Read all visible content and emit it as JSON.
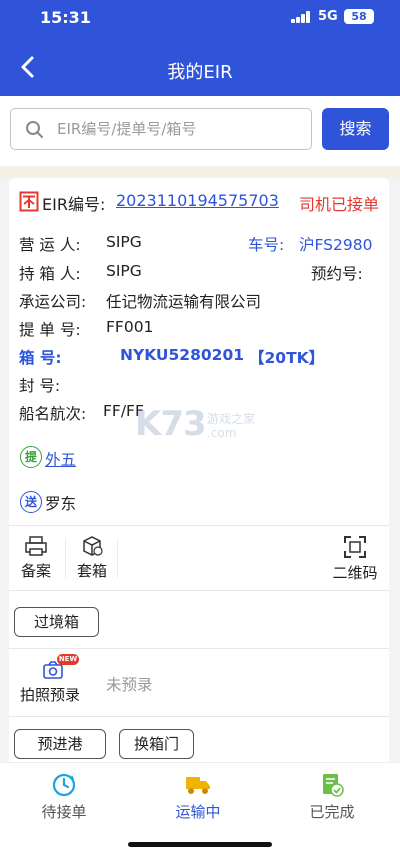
{
  "status": {
    "time": "15:31",
    "network": "5G",
    "battery": "58"
  },
  "nav": {
    "title": "我的EIR"
  },
  "search": {
    "placeholder": "EIR编号/提单号/箱号",
    "button": "搜索"
  },
  "card": {
    "eir_label": "EIR编号:",
    "eir_number": "2023110194575703",
    "status": "司机已接单",
    "operator_label": "营 运 人:",
    "operator_value": "SIPG",
    "plate_label": "车号:",
    "plate_value": "沪FS2980",
    "holder_label": "持 箱 人:",
    "holder_value": "SIPG",
    "appointment_label": "预约号:",
    "carrier_label": "承运公司:",
    "carrier_value": "任记物流运输有限公司",
    "bl_label": "提 单 号:",
    "bl_value": "FF001",
    "container_label": "箱      号:",
    "container_value": "NYKU5280201",
    "container_type": "【20TK】",
    "seal_label": "封      号:",
    "vessel_label": "船名航次:",
    "vessel_value": "FF/FF",
    "pickup_badge": "提",
    "pickup_value": "外五",
    "deliver_badge": "送",
    "deliver_value": "罗东",
    "tools": {
      "record": "备案",
      "cover": "套箱",
      "qrcode": "二维码"
    },
    "cross_border_button": "过境箱",
    "photo_label": "拍照预录",
    "new_badge": "NEW",
    "prerecord_status": "未预录",
    "pre_entry_button": "预进港",
    "change_gate_button": "换箱门"
  },
  "tabs": [
    {
      "label": "待接单",
      "icon": "pending-clock-icon",
      "color": "#2f54d9"
    },
    {
      "label": "运输中",
      "icon": "truck-icon",
      "color": "#2f54d9"
    },
    {
      "label": "已完成",
      "icon": "completed-doc-icon",
      "color": "#555555"
    }
  ],
  "watermark": {
    "brand": "K73",
    "sub": "游戏之家",
    "domain": ".com"
  }
}
